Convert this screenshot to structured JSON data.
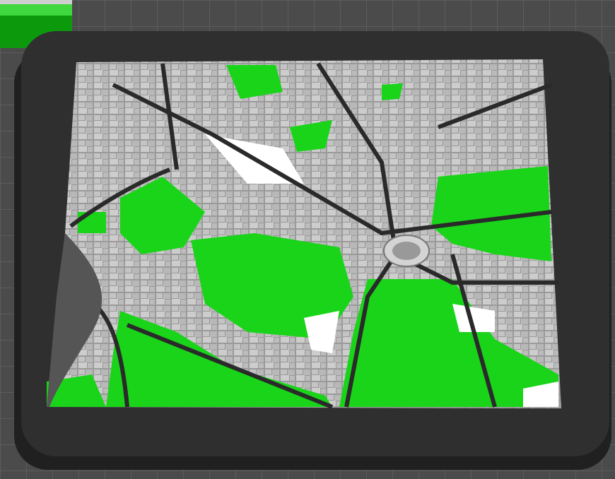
{
  "scene": {
    "type": "3d-printed city map model in slicer viewport",
    "colors": {
      "bed": "#4b4b4b",
      "grid_line": "#5c5c5c",
      "frame": "#2f2f2f",
      "buildings": "#bdbdbd",
      "ground": "#ffffff",
      "parks": "#19d419",
      "roads": "#2a2a2a"
    }
  }
}
